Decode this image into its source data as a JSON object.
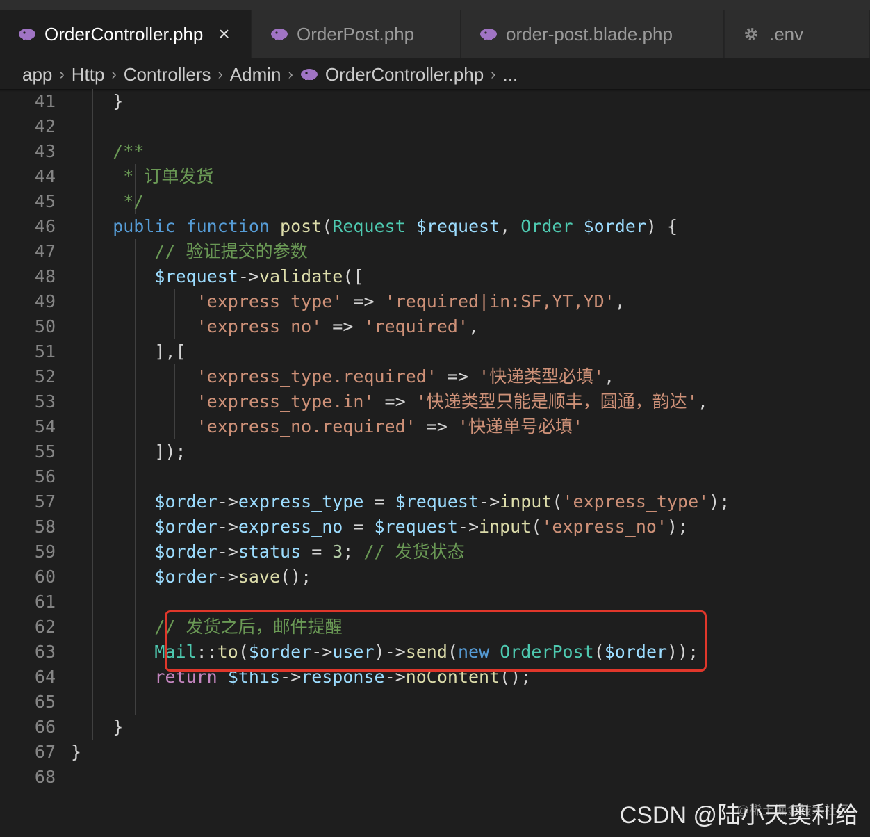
{
  "tabs": [
    {
      "label": "OrderController.php",
      "icon": "php-elephant-icon",
      "active": true,
      "close": "×"
    },
    {
      "label": "OrderPost.php",
      "icon": "php-elephant-icon",
      "active": false
    },
    {
      "label": "order-post.blade.php",
      "icon": "php-elephant-icon",
      "active": false
    },
    {
      "label": ".env",
      "icon": "gear-icon",
      "active": false
    }
  ],
  "breadcrumb": [
    "app",
    "Http",
    "Controllers",
    "Admin",
    "OrderController.php",
    "..."
  ],
  "line_numbers": [
    "41",
    "42",
    "43",
    "44",
    "45",
    "46",
    "47",
    "48",
    "49",
    "50",
    "51",
    "52",
    "53",
    "54",
    "55",
    "56",
    "57",
    "58",
    "59",
    "60",
    "61",
    "62",
    "63",
    "64",
    "65",
    "66",
    "67",
    "68"
  ],
  "code_lines": [
    [
      [
        "op",
        "    }"
      ]
    ],
    [],
    [
      [
        "com",
        "    /**"
      ]
    ],
    [
      [
        "com",
        "     * 订单发货"
      ]
    ],
    [
      [
        "com",
        "     */"
      ]
    ],
    [
      [
        "kw",
        "    public function "
      ],
      [
        "fn",
        "post"
      ],
      [
        "op",
        "("
      ],
      [
        "ty",
        "Request "
      ],
      [
        "var",
        "$request"
      ],
      [
        "op",
        ", "
      ],
      [
        "ty",
        "Order "
      ],
      [
        "var",
        "$order"
      ],
      [
        "op",
        ") {"
      ]
    ],
    [
      [
        "com",
        "        // 验证提交的参数"
      ]
    ],
    [
      [
        "var",
        "        $request"
      ],
      [
        "op",
        "->"
      ],
      [
        "fn",
        "validate"
      ],
      [
        "op",
        "(["
      ]
    ],
    [
      [
        "str",
        "            'express_type'"
      ],
      [
        "op",
        " => "
      ],
      [
        "str",
        "'required|in:SF,YT,YD'"
      ],
      [
        "op",
        ","
      ]
    ],
    [
      [
        "str",
        "            'express_no'"
      ],
      [
        "op",
        " => "
      ],
      [
        "str",
        "'required'"
      ],
      [
        "op",
        ","
      ]
    ],
    [
      [
        "op",
        "        ],["
      ]
    ],
    [
      [
        "str",
        "            'express_type.required'"
      ],
      [
        "op",
        " => "
      ],
      [
        "str",
        "'快递类型必填'"
      ],
      [
        "op",
        ","
      ]
    ],
    [
      [
        "str",
        "            'express_type.in'"
      ],
      [
        "op",
        " => "
      ],
      [
        "str",
        "'快递类型只能是顺丰，圆通，韵达'"
      ],
      [
        "op",
        ","
      ]
    ],
    [
      [
        "str",
        "            'express_no.required'"
      ],
      [
        "op",
        " => "
      ],
      [
        "str",
        "'快递单号必填'"
      ]
    ],
    [
      [
        "op",
        "        ]);"
      ]
    ],
    [],
    [
      [
        "var",
        "        $order"
      ],
      [
        "op",
        "->"
      ],
      [
        "var",
        "express_type"
      ],
      [
        "op",
        " = "
      ],
      [
        "var",
        "$request"
      ],
      [
        "op",
        "->"
      ],
      [
        "fn",
        "input"
      ],
      [
        "op",
        "("
      ],
      [
        "str",
        "'express_type'"
      ],
      [
        "op",
        ");"
      ]
    ],
    [
      [
        "var",
        "        $order"
      ],
      [
        "op",
        "->"
      ],
      [
        "var",
        "express_no"
      ],
      [
        "op",
        " = "
      ],
      [
        "var",
        "$request"
      ],
      [
        "op",
        "->"
      ],
      [
        "fn",
        "input"
      ],
      [
        "op",
        "("
      ],
      [
        "str",
        "'express_no'"
      ],
      [
        "op",
        ");"
      ]
    ],
    [
      [
        "var",
        "        $order"
      ],
      [
        "op",
        "->"
      ],
      [
        "var",
        "status"
      ],
      [
        "op",
        " = "
      ],
      [
        "num",
        "3"
      ],
      [
        "op",
        "; "
      ],
      [
        "com",
        "// 发货状态"
      ]
    ],
    [
      [
        "var",
        "        $order"
      ],
      [
        "op",
        "->"
      ],
      [
        "fn",
        "save"
      ],
      [
        "op",
        "();"
      ]
    ],
    [],
    [
      [
        "com",
        "        // 发货之后，邮件提醒"
      ]
    ],
    [
      [
        "ty",
        "        Mail"
      ],
      [
        "op",
        "::"
      ],
      [
        "fn",
        "to"
      ],
      [
        "op",
        "("
      ],
      [
        "var",
        "$order"
      ],
      [
        "op",
        "->"
      ],
      [
        "var",
        "user"
      ],
      [
        "op",
        ")->"
      ],
      [
        "fn",
        "send"
      ],
      [
        "op",
        "("
      ],
      [
        "kw",
        "new "
      ],
      [
        "ty",
        "OrderPost"
      ],
      [
        "op",
        "("
      ],
      [
        "var",
        "$order"
      ],
      [
        "op",
        "));"
      ]
    ],
    [
      [
        "kwf",
        "        return "
      ],
      [
        "var",
        "$this"
      ],
      [
        "op",
        "->"
      ],
      [
        "var",
        "response"
      ],
      [
        "op",
        "->"
      ],
      [
        "fn",
        "noContent"
      ],
      [
        "op",
        "();"
      ]
    ],
    [],
    [
      [
        "op",
        "    }"
      ]
    ],
    [
      [
        "op",
        "}"
      ]
    ],
    []
  ],
  "watermark": "CSDN @陆小天奥利给",
  "watermark_faint": "@稀土掘金技术社区"
}
